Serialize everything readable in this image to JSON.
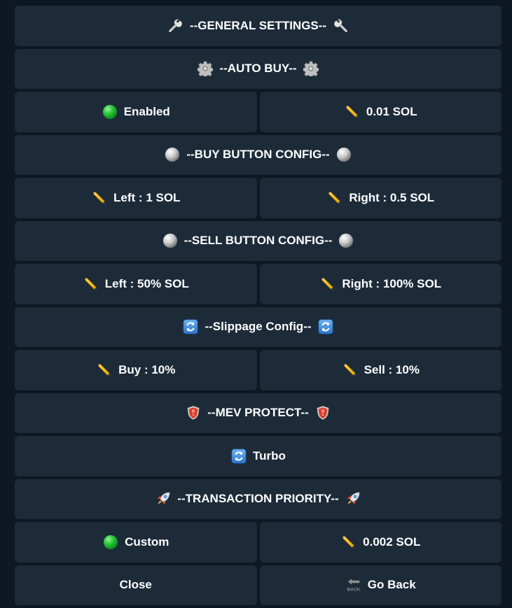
{
  "general": {
    "label": "--GENERAL SETTINGS--",
    "icon": "wrench-icon"
  },
  "autobuy": {
    "label": "--AUTO BUY--",
    "status": "Enabled",
    "amount": "0.01 SOL"
  },
  "buy_cfg": {
    "label": "--BUY BUTTON CONFIG--",
    "left": "Left : 1 SOL",
    "right": "Right : 0.5 SOL"
  },
  "sell_cfg": {
    "label": "--SELL BUTTON CONFIG--",
    "left": "Left : 50% SOL",
    "right": "Right : 100% SOL"
  },
  "slippage": {
    "label": "--Slippage Config--",
    "buy": "Buy : 10%",
    "sell": "Sell : 10%"
  },
  "mev": {
    "label": "--MEV PROTECT--",
    "mode": "Turbo"
  },
  "priority": {
    "label": "--TRANSACTION PRIORITY--",
    "mode": "Custom",
    "amount": "0.002 SOL"
  },
  "footer": {
    "close": "Close",
    "back": "Go Back",
    "back_icon_text": "BACK"
  },
  "colors": {
    "background": "#0d1822",
    "button": "#1d2b39",
    "text": "#ffffff",
    "status_green": "#2ecc40"
  }
}
